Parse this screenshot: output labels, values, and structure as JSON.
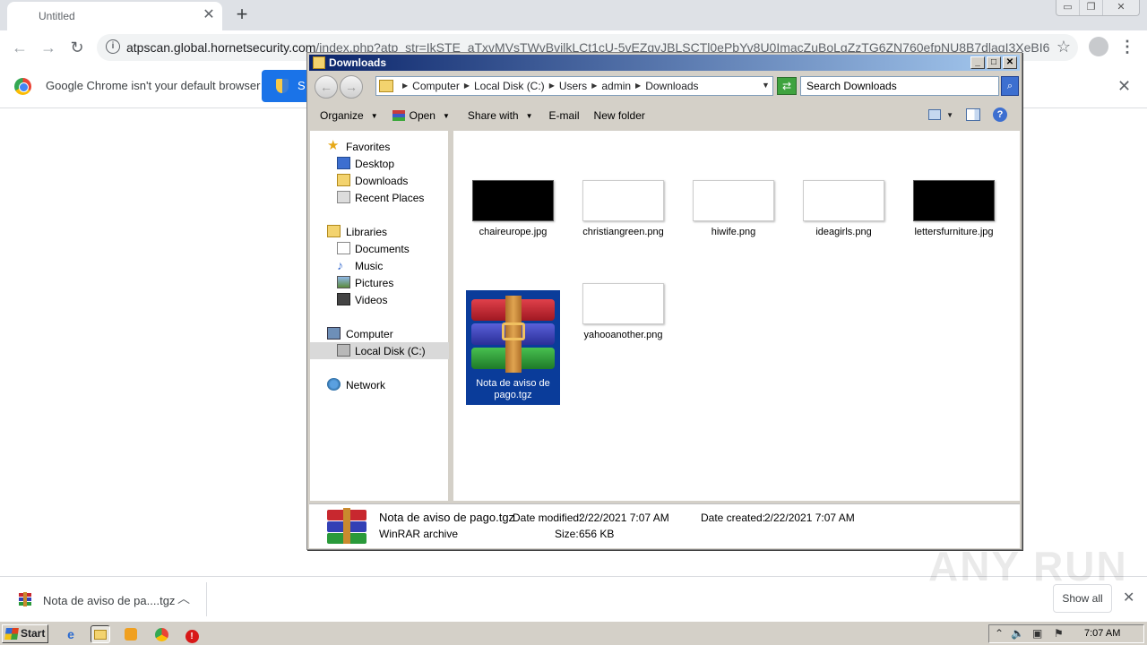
{
  "browser": {
    "tab_title": "Untitled",
    "url_host": "atpscan.global.hornetsecurity.com",
    "url_path": "/index.php?atp_str=IkSTE_aTxvMVsTWvBvilkLCt1cU-5vEZqvJBLSCTl0ePbYv8U0ImacZuBoLgZzTG6ZN760efpNU8B7dlagI3XeBI66...",
    "infobar_text": "Google Chrome isn't your default browser",
    "infobar_button": "S"
  },
  "explorer": {
    "title": "Downloads",
    "breadcrumbs": [
      "Computer",
      "Local Disk (C:)",
      "Users",
      "admin",
      "Downloads"
    ],
    "search_placeholder": "Search Downloads",
    "commands": {
      "organize": "Organize",
      "open": "Open",
      "share": "Share with",
      "email": "E-mail",
      "new_folder": "New folder"
    },
    "nav": {
      "favorites": "Favorites",
      "desktop": "Desktop",
      "downloads": "Downloads",
      "recent": "Recent Places",
      "libraries": "Libraries",
      "documents": "Documents",
      "music": "Music",
      "pictures": "Pictures",
      "videos": "Videos",
      "computer": "Computer",
      "local_disk": "Local Disk (C:)",
      "network": "Network"
    },
    "files": [
      {
        "name": "chaireurope.jpg",
        "thumb": "dark"
      },
      {
        "name": "christiangreen.png",
        "thumb": "light"
      },
      {
        "name": "hiwife.png",
        "thumb": "light"
      },
      {
        "name": "ideagirls.png",
        "thumb": "light"
      },
      {
        "name": "lettersfurniture.jpg",
        "thumb": "dark"
      },
      {
        "name": "Nota de aviso de pago.tgz",
        "thumb": "rar",
        "selected": true
      },
      {
        "name": "yahooanother.png",
        "thumb": "light"
      }
    ],
    "details": {
      "name": "Nota de aviso de pago.tgz",
      "type": "WinRAR archive",
      "modified_label": "Date modified:",
      "modified": "2/22/2021 7:07 AM",
      "created_label": "Date created:",
      "created": "2/22/2021 7:07 AM",
      "size_label": "Size:",
      "size": "656 KB"
    }
  },
  "download_shelf": {
    "item_name": "Nota de aviso de pa....tgz",
    "show_all": "Show all"
  },
  "taskbar": {
    "start": "Start",
    "clock": "7:07 AM"
  },
  "watermark": "ANY RUN"
}
